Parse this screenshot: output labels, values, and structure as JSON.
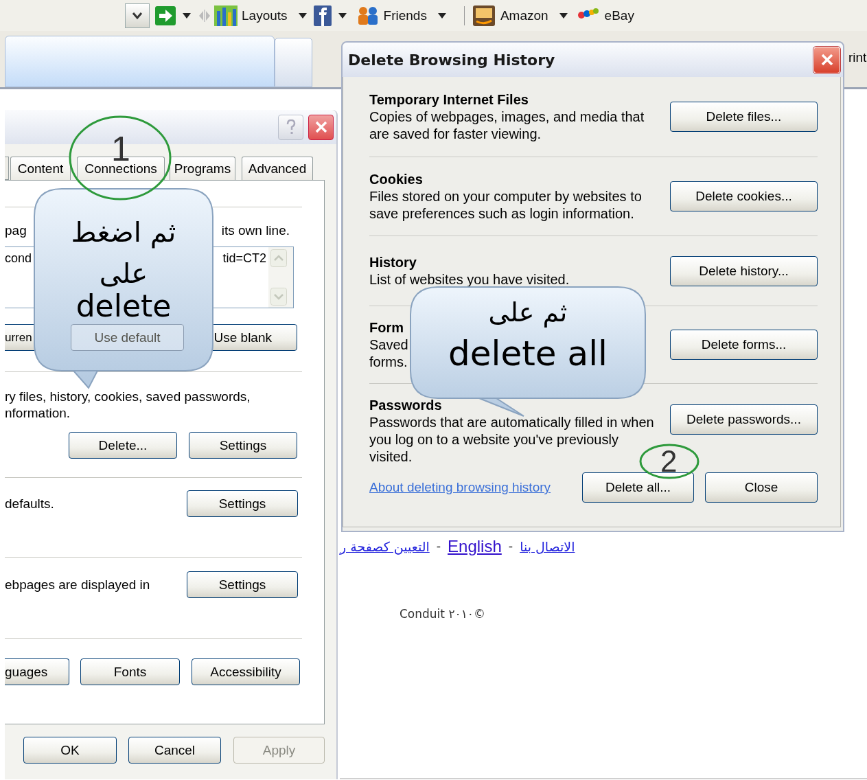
{
  "toolbar": {
    "links": [
      {
        "label": "Layouts",
        "kind": "layouts"
      },
      {
        "label": "Friends",
        "kind": "friends"
      },
      {
        "label": "Amazon",
        "kind": "amazon"
      },
      {
        "label": "eBay",
        "kind": "ebay"
      }
    ],
    "cut_label": "rint"
  },
  "options_dialog": {
    "tabs": [
      {
        "label": "Content",
        "selected": false
      },
      {
        "label": "Connections",
        "selected": false
      },
      {
        "label": "Programs",
        "selected": false
      },
      {
        "label": "Advanced",
        "selected": false
      }
    ],
    "home_page": {
      "hint_parts": [
        "pag",
        "its own line."
      ],
      "url_parts": [
        "cond",
        "tid=CT2"
      ],
      "buttons": [
        {
          "label": "urren",
          "disabled": false
        },
        {
          "label": "Use default",
          "disabled": true
        },
        {
          "label": "Use blank",
          "disabled": false
        }
      ]
    },
    "browsing_history": {
      "lines": [
        "ry files, history, cookies, saved passwords,",
        "nformation."
      ],
      "buttons": [
        "Delete...",
        "Settings"
      ]
    },
    "search": {
      "text": "defaults.",
      "button": "Settings"
    },
    "tabs_section": {
      "text": "ebpages are displayed in",
      "button": "Settings"
    },
    "appearance_buttons": [
      "guages",
      "Fonts",
      "Accessibility"
    ],
    "footer_buttons": [
      {
        "label": "OK",
        "disabled": false
      },
      {
        "label": "Cancel",
        "disabled": false
      },
      {
        "label": "Apply",
        "disabled": true
      }
    ]
  },
  "delete_dialog": {
    "title": "Delete Browsing History",
    "sections": [
      {
        "heading": "Temporary Internet Files",
        "description": "Copies of webpages, images, and media that are saved for faster viewing.",
        "button": "Delete files..."
      },
      {
        "heading": "Cookies",
        "description": "Files stored on your computer by websites to save preferences such as login information.",
        "button": "Delete cookies..."
      },
      {
        "heading": "History",
        "description": "List of websites you have visited.",
        "button": "Delete history..."
      },
      {
        "heading": "Form",
        "description": "Saved\nforms.",
        "button": "Delete forms..."
      },
      {
        "heading": "Passwords",
        "description": "Passwords that are automatically filled in when you log on to a website you've previously visited.",
        "button": "Delete passwords..."
      }
    ],
    "link": "About deleting browsing history",
    "buttons": [
      "Delete all...",
      "Close"
    ]
  },
  "page_links": [
    {
      "kind": "link",
      "label": "التعيين كصفحة ر"
    },
    {
      "kind": "separator",
      "label": "-"
    },
    {
      "kind": "link",
      "label": "English"
    },
    {
      "kind": "separator",
      "label": "-"
    },
    {
      "kind": "link",
      "label": "الاتصال بنا"
    }
  ],
  "copyright": "Conduit ٢٠١٠©",
  "callouts": [
    {
      "step": "1",
      "lines": [
        "ثم اضغط",
        "على",
        "delete"
      ]
    },
    {
      "step": "2",
      "lines": [
        "ثم على",
        "delete all"
      ]
    }
  ]
}
